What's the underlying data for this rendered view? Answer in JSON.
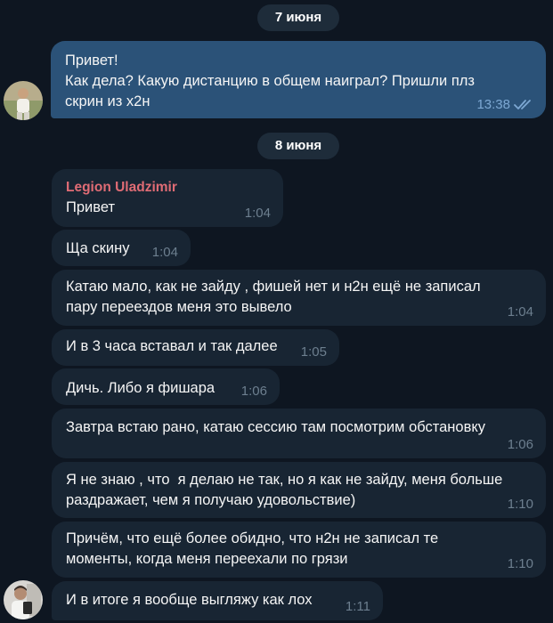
{
  "dates": {
    "first": "7 июня",
    "second": "8 июня"
  },
  "outgoing": {
    "text": "Привет!\nКак дела? Какую дистанцию в общем наиграл? Пришли плз\nскрин из x2н",
    "time": "13:38",
    "status": "read-double-check-icon"
  },
  "incoming": {
    "sender": "Legion Uladzimir",
    "messages": [
      {
        "text": "Привет",
        "time": "1:04"
      },
      {
        "text": "Ща скину",
        "time": "1:04"
      },
      {
        "text": "Катаю мало, как не зайду , фишей нет и н2н ещё не записал\nпару переездов меня это вывело",
        "time": "1:04"
      },
      {
        "text": "И в 3 часа вставал и так далее",
        "time": "1:05"
      },
      {
        "text": "Дичь. Либо я фишара",
        "time": "1:06"
      },
      {
        "text": "Завтра встаю рано, катаю сессию там посмотрим обстановку",
        "time": "1:06"
      },
      {
        "text": "Я не знаю , что  я делаю не так, но я как не зайду, меня больше\nраздражает, чем я получаю удовольствие)",
        "time": "1:10"
      },
      {
        "text": "Причём, что ещё более обидно, что н2н не записал те\nмоменты, когда меня переехали по грязи",
        "time": "1:10"
      },
      {
        "text": "И в итоге я вообще выгляжу как лох",
        "time": "1:11"
      }
    ]
  },
  "colors": {
    "background": "#0e1621",
    "outgoing_bubble": "#2b5278",
    "incoming_bubble": "#182533",
    "sender_name": "#e06c75",
    "date_pill": "#1e2c3a"
  }
}
